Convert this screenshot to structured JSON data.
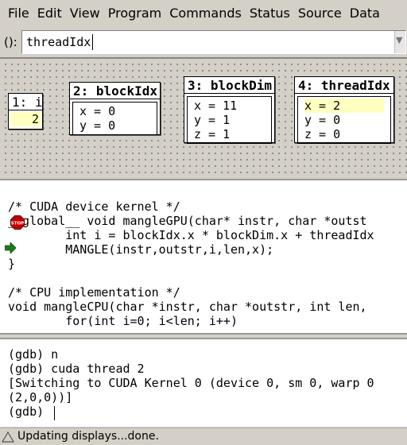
{
  "menu": [
    "File",
    "Edit",
    "View",
    "Program",
    "Commands",
    "Status",
    "Source",
    "Data"
  ],
  "argbar": {
    "label": "():",
    "value": "threadIdx"
  },
  "displays": {
    "i": {
      "title_num": "1:",
      "title_name": "i",
      "value": "2"
    },
    "blockIdx": {
      "title_num": "2:",
      "title_name": "blockIdx",
      "x": "x = 0",
      "y": "y = 0"
    },
    "blockDim": {
      "title_num": "3:",
      "title_name": "blockDim",
      "x": "x = 11",
      "y": "y = 1",
      "z": "z = 1"
    },
    "threadIdx": {
      "title_num": "4:",
      "title_name": "threadIdx",
      "x": "x = 2",
      "y": "y = 0",
      "z": "z = 0"
    }
  },
  "source": {
    "lines": [
      "/* CUDA device kernel */",
      "__global__ void mangleGPU(char* instr, char *outst",
      "        int i = blockIdx.x * blockDim.x + threadIdx",
      "        MANGLE(instr,outstr,i,len,x);",
      "}",
      "",
      "/* CPU implementation */",
      "void mangleCPU(char *instr, char *outstr, int len,",
      "        for(int i=0; i<len; i++)"
    ],
    "stop_label": "STOP"
  },
  "console": {
    "lines": [
      "(gdb) n",
      "(gdb) cuda thread 2",
      "[Switching to CUDA Kernel 0 (device 0, sm 0, warp 0",
      "(2,0,0))]",
      "(gdb) "
    ]
  },
  "status": {
    "text": "Updating displays...done."
  }
}
